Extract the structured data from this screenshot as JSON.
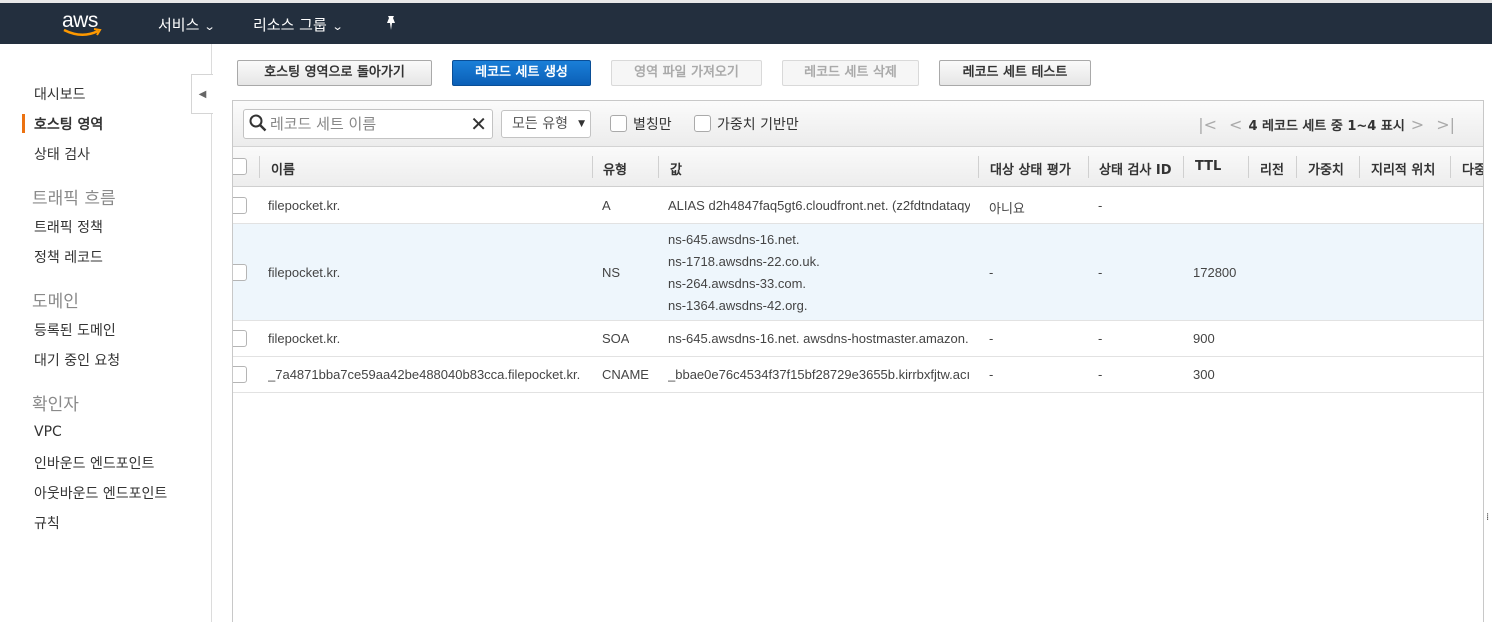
{
  "topbar": {
    "logo_text": "aws",
    "nav": [
      {
        "label": "서비스"
      },
      {
        "label": "리소스 그룹"
      }
    ]
  },
  "sidebar": {
    "items": [
      {
        "label": "대시보드"
      },
      {
        "label": "호스팅 영역"
      },
      {
        "label": "상태 검사"
      },
      {
        "label": "트래픽 흐름",
        "heading": true
      },
      {
        "label": "트래픽 정책"
      },
      {
        "label": "정책 레코드"
      },
      {
        "label": "도메인",
        "heading": true
      },
      {
        "label": "등록된 도메인"
      },
      {
        "label": "대기 중인 요청"
      },
      {
        "label": "확인자",
        "heading": true
      },
      {
        "label": "VPC"
      },
      {
        "label": "인바운드 엔드포인트"
      },
      {
        "label": "아웃바운드 엔드포인트"
      },
      {
        "label": "규칙"
      }
    ],
    "active": "호스팅 영역"
  },
  "toolbar": {
    "back": "호스팅 영역으로 돌아가기",
    "create": "레코드 세트 생성",
    "import": "영역 파일 가져오기",
    "delete": "레코드 세트 삭제",
    "test": "레코드 세트 테스트"
  },
  "filter": {
    "search_placeholder": "레코드 세트 이름",
    "type_select": "모든 유형",
    "alias_only": "별칭만",
    "weighted_only": "가중치 기반만",
    "pager_text": "4 레코드 세트 중 1~4 표시"
  },
  "table": {
    "columns": [
      "이름",
      "유형",
      "값",
      "대상 상태 평가",
      "상태 검사 ID",
      "TTL",
      "리전",
      "가중치",
      "지리적 위치",
      "다중"
    ],
    "rows": [
      {
        "name": "filepocket.kr.",
        "type": "A",
        "values": [
          "ALIAS d2h4847faq5gt6.cloudfront.net. (z2fdtndataqy"
        ],
        "eval": "아니요",
        "health": "-",
        "ttl": ""
      },
      {
        "name": "filepocket.kr.",
        "type": "NS",
        "values": [
          "ns-645.awsdns-16.net.",
          "ns-1718.awsdns-22.co.uk.",
          "ns-264.awsdns-33.com.",
          "ns-1364.awsdns-42.org."
        ],
        "eval": "-",
        "health": "-",
        "ttl": "172800"
      },
      {
        "name": "filepocket.kr.",
        "type": "SOA",
        "values": [
          "ns-645.awsdns-16.net. awsdns-hostmaster.amazon."
        ],
        "eval": "-",
        "health": "-",
        "ttl": "900"
      },
      {
        "name": "_7a4871bba7ce59aa42be488040b83cca.filepocket.kr.",
        "type": "CNAME",
        "values": [
          "_bbae0e76c4534f37f15bf28729e3655b.kirrbxfjtw.acı"
        ],
        "eval": "-",
        "health": "-",
        "ttl": "300"
      }
    ]
  },
  "colors": {
    "topbar": "#232f3e",
    "primary": "#0b5fb7",
    "accent": "#ec7211",
    "selected_row": "#eef6fc"
  }
}
